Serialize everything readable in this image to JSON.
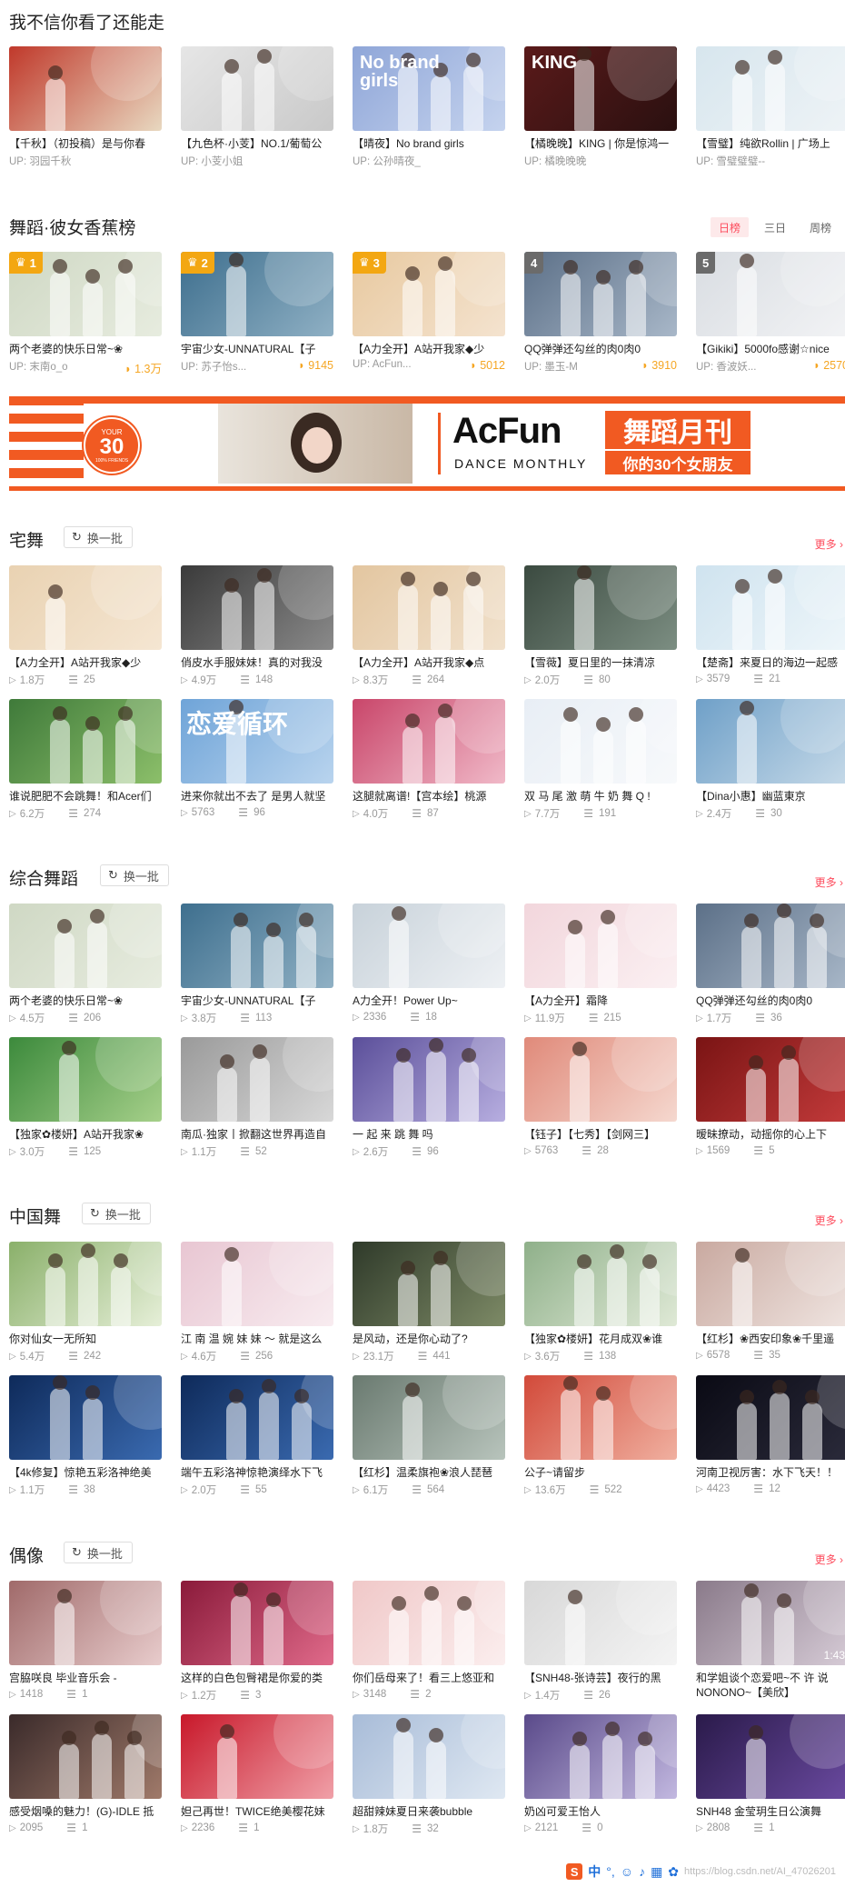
{
  "page_title": "我不信你看了还能走",
  "top_row": [
    {
      "title": "【千秋】（初投稿）是与你春",
      "up": "UP: 羽园千秋",
      "colors": [
        "#c0392b",
        "#e8d8c0"
      ]
    },
    {
      "title": "【九色杯·小芰】NO.1/葡萄公",
      "up": "UP: 小芰小姐",
      "colors": [
        "#e6e6e6",
        "#c9c9c9"
      ]
    },
    {
      "title": "【晴夜】No brand girls",
      "up": "UP: 公孙晴夜_",
      "overlay": "No brand girls",
      "colors": [
        "#8fa6d8",
        "#c5d3ee"
      ]
    },
    {
      "title": "【橘晚晚】KING | 你是惊鸿一",
      "up": "UP: 橘晚晚晚",
      "overlay": "KING",
      "colors": [
        "#5a1a1a",
        "#2a1010"
      ]
    },
    {
      "title": "【雪璧】纯欲Rollin | 广场上",
      "up": "UP: 雪璧璧璧--",
      "colors": [
        "#d7e6ee",
        "#eef3f6"
      ]
    }
  ],
  "ranking": {
    "title": "舞蹈·彼女香蕉榜",
    "tabs": [
      "日榜",
      "三日",
      "周榜"
    ],
    "active_tab": "日榜",
    "items": [
      {
        "rank": "1",
        "title": "两个老婆的快乐日常~❀",
        "up": "UP: 末南o_o",
        "bananas": "1.3万",
        "colors": [
          "#cfd8c4",
          "#e7ecdf"
        ]
      },
      {
        "rank": "2",
        "title": "宇宙少女-UNNATURAL【子",
        "up": "UP: 苏子怡s...",
        "bananas": "9145",
        "colors": [
          "#3e6f8e",
          "#8fb0c4"
        ]
      },
      {
        "rank": "3",
        "title": "【A力全开】A站开我家◆少",
        "up": "UP: AcFun...",
        "bananas": "5012",
        "colors": [
          "#e8c9a0",
          "#f4e3cf"
        ]
      },
      {
        "rank": "4",
        "title": "QQ弹弹还勾丝的肉0肉0",
        "up": "UP: 墨玉-M",
        "bananas": "3910",
        "colors": [
          "#5c7088",
          "#a8b7c8"
        ]
      },
      {
        "rank": "5",
        "title": "【Gikiki】5000fo感谢☆nice",
        "up": "UP: 香波妖...",
        "bananas": "2570",
        "colors": [
          "#d9dde2",
          "#f2f3f5"
        ]
      }
    ]
  },
  "banner": {
    "badge_big": "30",
    "badge_top": "YOUR",
    "badge_bottom": "100% FRIENDS",
    "brand": "AcFun",
    "brand_sub": "DANCE MONTHLY",
    "tag_title": "舞蹈月刊",
    "tag_sub": "你的30个女朋友"
  },
  "sections": [
    {
      "title": "宅舞",
      "refresh": "换一批",
      "more": "更多",
      "cards": [
        {
          "title": "【A力全开】A站开我家◆少",
          "plays": "1.8万",
          "danmaku": "25",
          "colors": [
            "#e9d2b2",
            "#f5e6d2"
          ]
        },
        {
          "title": "俏皮水手服妹妹！真的对我没",
          "plays": "4.9万",
          "danmaku": "148",
          "colors": [
            "#3a3a3a",
            "#8a8a8a"
          ]
        },
        {
          "title": "【A力全开】A站开我家◆点",
          "plays": "8.3万",
          "danmaku": "264",
          "colors": [
            "#e3c6a0",
            "#f1e1cc"
          ]
        },
        {
          "title": "【雪薇】夏日里的一抹清凉",
          "plays": "2.0万",
          "danmaku": "80",
          "colors": [
            "#3b4a40",
            "#7c8e82"
          ]
        },
        {
          "title": "【楚斋】来夏日的海边一起感",
          "plays": "3579",
          "danmaku": "21",
          "colors": [
            "#cfe3ef",
            "#eef6fa"
          ]
        },
        {
          "title": "谁说肥肥不会跳舞！和Acer们",
          "plays": "6.2万",
          "danmaku": "274",
          "colors": [
            "#3f7a3a",
            "#8cbf6a"
          ]
        },
        {
          "title": "进来你就出不去了 是男人就坚",
          "plays": "5763",
          "danmaku": "96",
          "overlay": "恋爱循环",
          "colors": [
            "#6fa4d8",
            "#b9d4ee"
          ]
        },
        {
          "title": "这腿就离谱!【宫本绘】桃源",
          "plays": "4.0万",
          "danmaku": "87",
          "colors": [
            "#c9466a",
            "#f0b9c8"
          ]
        },
        {
          "title": "双 马 尾 激 萌 牛 奶 舞 Q !",
          "plays": "7.7万",
          "danmaku": "191",
          "colors": [
            "#e8eef5",
            "#f7f9fb"
          ]
        },
        {
          "title": "【Dina小惠】幽蓝東京",
          "plays": "2.4万",
          "danmaku": "30",
          "colors": [
            "#6fa0c8",
            "#c5d9e8"
          ]
        }
      ]
    },
    {
      "title": "综合舞蹈",
      "refresh": "换一批",
      "more": "更多",
      "cards": [
        {
          "title": "两个老婆的快乐日常~❀",
          "plays": "4.5万",
          "danmaku": "206",
          "colors": [
            "#cfd8c4",
            "#e7ecdf"
          ]
        },
        {
          "title": "宇宙少女-UNNATURAL【子",
          "plays": "3.8万",
          "danmaku": "113",
          "colors": [
            "#3e6f8e",
            "#8fb0c4"
          ]
        },
        {
          "title": "A力全开！Power Up~",
          "plays": "2336",
          "danmaku": "18",
          "colors": [
            "#c8d2da",
            "#eef1f4"
          ]
        },
        {
          "title": "【A力全开】霜降",
          "plays": "11.9万",
          "danmaku": "215",
          "colors": [
            "#f2d6dc",
            "#fbf0f2"
          ]
        },
        {
          "title": "QQ弹弹还勾丝的肉0肉0",
          "plays": "1.7万",
          "danmaku": "36",
          "colors": [
            "#5c7088",
            "#a8b7c8"
          ]
        },
        {
          "title": "【独家✿楼妍】A站开我家❀",
          "plays": "3.0万",
          "danmaku": "125",
          "colors": [
            "#3c8a3c",
            "#a6d08a"
          ]
        },
        {
          "title": "南瓜·独家丨掀翻这世界再造自",
          "plays": "1.1万",
          "danmaku": "52",
          "colors": [
            "#9a9a9a",
            "#d8d8d8"
          ]
        },
        {
          "title": "一 起 来 跳 舞 吗",
          "plays": "2.6万",
          "danmaku": "96",
          "colors": [
            "#5b4f9a",
            "#b7aee0"
          ]
        },
        {
          "title": "【钰子】【七秀】【剑网三】",
          "plays": "5763",
          "danmaku": "28",
          "colors": [
            "#e08a7a",
            "#f5d8cf"
          ]
        },
        {
          "title": "暧昧撩动，动摇你的心上下",
          "plays": "1569",
          "danmaku": "5",
          "colors": [
            "#7a1414",
            "#c23a3a"
          ]
        }
      ]
    },
    {
      "title": "中国舞",
      "refresh": "换一批",
      "more": "更多",
      "cards": [
        {
          "title": "你对仙女一无所知",
          "plays": "5.4万",
          "danmaku": "242",
          "colors": [
            "#8ab06a",
            "#e6efd8"
          ]
        },
        {
          "title": "江 南 温 婉 妹 妹 ～ 就是这么",
          "plays": "4.6万",
          "danmaku": "256",
          "colors": [
            "#e8c6d2",
            "#f8ecf0"
          ]
        },
        {
          "title": "是风动，还是你心动了?",
          "plays": "23.1万",
          "danmaku": "441",
          "colors": [
            "#2f3a2a",
            "#7d8a66"
          ]
        },
        {
          "title": "【独家✿楼妍】花月成双❀谁",
          "plays": "3.6万",
          "danmaku": "138",
          "colors": [
            "#8fb08a",
            "#dfe9d6"
          ]
        },
        {
          "title": "【红杉】❀西安印象❀千里遥",
          "plays": "6578",
          "danmaku": "35",
          "colors": [
            "#c9a9a0",
            "#efe4e0"
          ]
        },
        {
          "title": "【4k修复】惊艳五彩洛神绝美",
          "plays": "1.1万",
          "danmaku": "38",
          "colors": [
            "#0e2a5a",
            "#3a6ab0"
          ]
        },
        {
          "title": "端午五彩洛神惊艳演绎水下飞",
          "plays": "2.0万",
          "danmaku": "55",
          "colors": [
            "#0e2a5a",
            "#3a6ab0"
          ]
        },
        {
          "title": "【红杉】温柔旗袍❀浪人琵琶",
          "plays": "6.1万",
          "danmaku": "564",
          "colors": [
            "#6a7a70",
            "#b8c4bc"
          ]
        },
        {
          "title": "公子~请留步",
          "plays": "13.6万",
          "danmaku": "522",
          "colors": [
            "#d24a3a",
            "#f0b0a0"
          ]
        },
        {
          "title": "河南卫视厉害：水下飞天！！",
          "plays": "4423",
          "danmaku": "12",
          "colors": [
            "#0a0a14",
            "#2a2a3a"
          ]
        }
      ]
    },
    {
      "title": "偶像",
      "refresh": "换一批",
      "more": "更多",
      "cards": [
        {
          "title": "宫脇咲良 毕业音乐会 -",
          "plays": "1418",
          "danmaku": "1",
          "colors": [
            "#a06a6a",
            "#e8cccc"
          ]
        },
        {
          "title": "这样的白色包臀裙是你爱的类",
          "plays": "1.2万",
          "danmaku": "3",
          "colors": [
            "#8a1a3a",
            "#e06a8a"
          ]
        },
        {
          "title": "你们岳母来了！看三上悠亚和",
          "plays": "3148",
          "danmaku": "2",
          "colors": [
            "#f0c8c8",
            "#fbeeee"
          ]
        },
        {
          "title": "【SNH48-张诗芸】夜行的黑",
          "plays": "1.4万",
          "danmaku": "26",
          "colors": [
            "#d8d8d8",
            "#f4f4f4"
          ]
        },
        {
          "title": "和学姐谈个恋爱吧~不 许 说 NONONO~【美欣】",
          "plays": "",
          "danmaku": "",
          "duration": "1:43",
          "colors": [
            "#8a7a8a",
            "#d6cbd6"
          ]
        },
        {
          "title": "感受烟嗓的魅力！(G)-IDLE 抵",
          "plays": "2095",
          "danmaku": "1",
          "colors": [
            "#3a2a2a",
            "#a07a6a"
          ]
        },
        {
          "title": "妲己再世！TWICE绝美樱花妹",
          "plays": "2236",
          "danmaku": "1",
          "colors": [
            "#c8182a",
            "#f0a0a8"
          ]
        },
        {
          "title": "超甜辣妹夏日来袭bubble",
          "plays": "1.8万",
          "danmaku": "32",
          "colors": [
            "#a8bcd8",
            "#dfe8f2"
          ]
        },
        {
          "title": "奶凶可爱王怡人",
          "plays": "2121",
          "danmaku": "0",
          "colors": [
            "#5a4a8a",
            "#c2b8e0"
          ]
        },
        {
          "title": "SNH48 金莹玥生日公演舞",
          "plays": "2808",
          "danmaku": "1",
          "colors": [
            "#2a1a4a",
            "#6a4aa0"
          ]
        }
      ]
    }
  ],
  "footer": {
    "ime": "中",
    "watermark": "https://blog.csdn.net/AI_47026201"
  }
}
